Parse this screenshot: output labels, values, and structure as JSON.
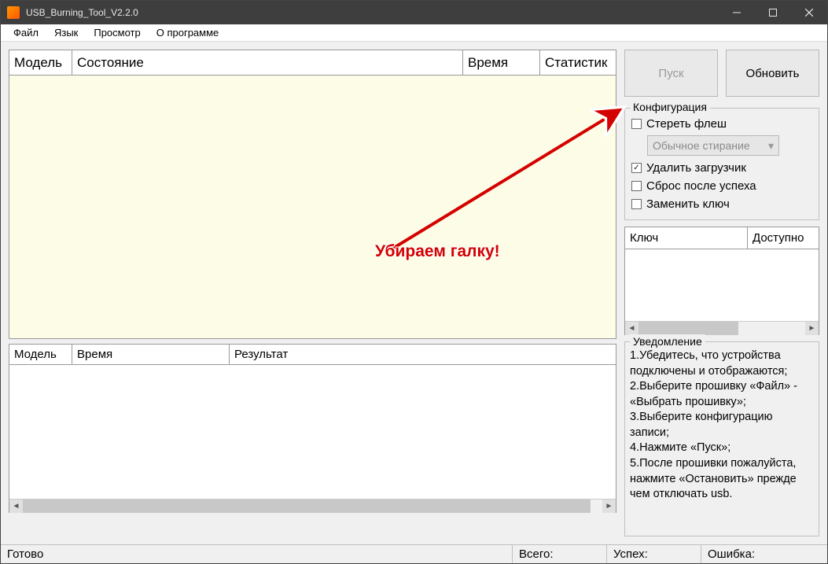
{
  "window": {
    "title": "USB_Burning_Tool_V2.2.0"
  },
  "menu": {
    "file": "Файл",
    "lang": "Язык",
    "view": "Просмотр",
    "about": "О программе"
  },
  "top_table": {
    "col_model": "Модель",
    "col_state": "Состояние",
    "col_time": "Время",
    "col_stats": "Статистик"
  },
  "bottom_table": {
    "col_model": "Модель",
    "col_time": "Время",
    "col_result": "Результат"
  },
  "buttons": {
    "start": "Пуск",
    "refresh": "Обновить"
  },
  "config": {
    "title": "Конфигурация",
    "erase_flash": "Стереть флеш",
    "erase_mode": "Обычное стирание",
    "erase_bootloader": "Удалить загрузчик",
    "reset_after": "Сброс после успеха",
    "replace_key": "Заменить ключ"
  },
  "key_table": {
    "col_key": "Ключ",
    "col_avail": "Доступно"
  },
  "notice": {
    "title": "Уведомление",
    "line1": "1.Убедитесь, что устройства подключены и отображаются;",
    "line2": "2.Выберите прошивку «Файл» - «Выбрать прошивку»;",
    "line3": "3.Выберите конфигурацию записи;",
    "line4": "4.Нажмите «Пуск»;",
    "line5": "5.После прошивки пожалуйста, нажмите «Остановить» прежде чем отключать usb."
  },
  "status": {
    "ready": "Готово",
    "total": "Всего:",
    "success": "Успех:",
    "error": "Ошибка:"
  },
  "annotation": {
    "text": "Убираем галку!"
  }
}
